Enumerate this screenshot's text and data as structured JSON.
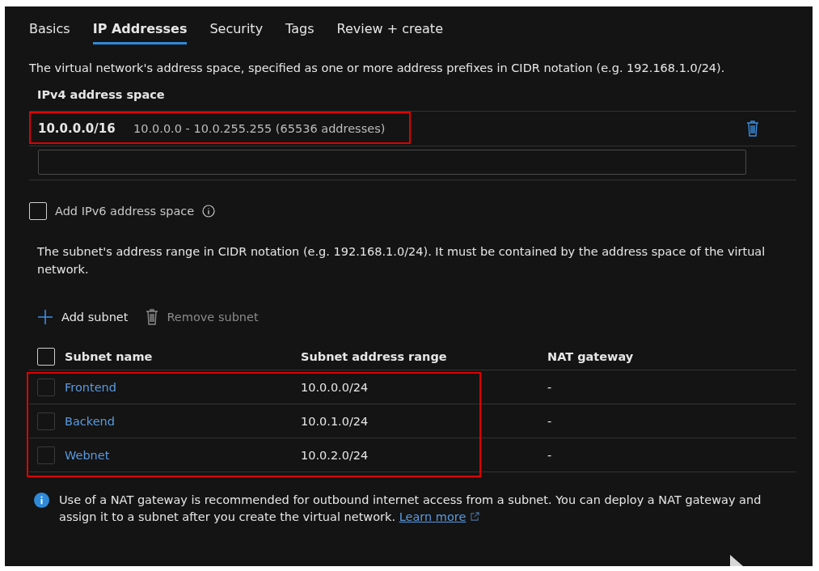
{
  "tabs": [
    {
      "label": "Basics",
      "selected": false
    },
    {
      "label": "IP Addresses",
      "selected": true
    },
    {
      "label": "Security",
      "selected": false
    },
    {
      "label": "Tags",
      "selected": false
    },
    {
      "label": "Review + create",
      "selected": false
    }
  ],
  "address_space_description": "The virtual network's address space, specified as one or more address prefixes in CIDR notation (e.g. 192.168.1.0/24).",
  "ipv4": {
    "heading": "IPv4 address space",
    "rows": [
      {
        "prefix": "10.0.0.0/16",
        "range": "10.0.0.0 - 10.0.255.255 (65536 addresses)"
      }
    ]
  },
  "ipv6": {
    "label": "Add IPv6 address space",
    "checked": false
  },
  "subnet_description": "The subnet's address range in CIDR notation (e.g. 192.168.1.0/24). It must be contained by the address space of the virtual network.",
  "toolbar": [
    {
      "kind": "add",
      "label": "Add subnet",
      "disabled": false
    },
    {
      "kind": "remove",
      "label": "Remove subnet",
      "disabled": true
    }
  ],
  "subnets": {
    "columns": [
      "Subnet name",
      "Subnet address range",
      "NAT gateway"
    ],
    "all_selected": false,
    "rows": [
      {
        "name": "Frontend",
        "range": "10.0.0.0/24",
        "nat": "-",
        "selected": false
      },
      {
        "name": "Backend",
        "range": "10.0.1.0/24",
        "nat": "-",
        "selected": false
      },
      {
        "name": "Webnet",
        "range": "10.0.2.0/24",
        "nat": "-",
        "selected": false
      }
    ]
  },
  "info": {
    "text": "Use of a NAT gateway is recommended for outbound internet access from a subnet. You can deploy a NAT gateway and assign it to a subnet after you create the virtual network.",
    "link": "Learn more"
  }
}
